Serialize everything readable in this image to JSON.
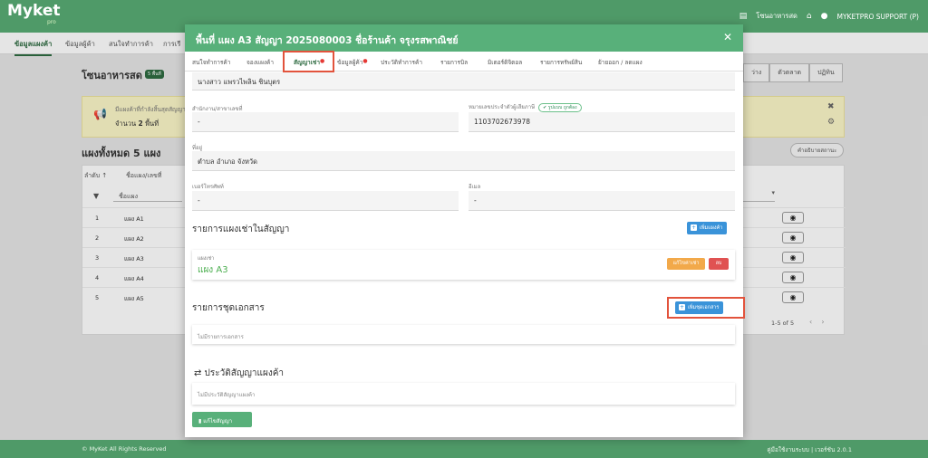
{
  "app": {
    "logo": "Myket",
    "logo_sub": "pro",
    "zone_link": "โซนอาหารสด",
    "user": "MYKETPRO SUPPORT (P)"
  },
  "nav": [
    "ข้อมูลแผงค้า",
    "ข้อมูลผู้ค้า",
    "สนใจทำการค้า",
    "การเรี"
  ],
  "page": {
    "title": "โซนอาหารสด",
    "count_badge": "5 พื้นที่",
    "right_tabs": [
      "ว่าง",
      "ตัวตลาด",
      "ปฏิทิน"
    ],
    "notice_line1": "มีแผงค้าที่กำลังสิ้นสุดสัญญา",
    "notice_line2_prefix": "จำนวน ",
    "notice_line2_count": "2",
    "notice_line2_suffix": " พื้นที่",
    "list_title": "แผงทั้งหมด 5 แผง",
    "help_btn": "คำอธิบายสถานะ",
    "table_headers": [
      "ลำดับ ↑",
      "ชื่อแผง/เลขที่"
    ],
    "filter_placeholder": "ชื่อแผง",
    "rows": [
      {
        "n": "1",
        "name": "แผง A1"
      },
      {
        "n": "2",
        "name": "แผง A2"
      },
      {
        "n": "3",
        "name": "แผง A3"
      },
      {
        "n": "4",
        "name": "แผง A4"
      },
      {
        "n": "5",
        "name": "แผง A5"
      }
    ],
    "pager": "1-5 of 5",
    "footer_left": "© MyKet All Rights Reserved",
    "footer_right": "คู่มือใช้งานระบบ | เวอร์ชัน 2.0.1"
  },
  "modal": {
    "title": "พื้นที่ แผง A3 สัญญา 2025080003 ชื่อร้านค้า จรุงรสพาณิชย์",
    "close": "✕",
    "tabs": [
      "สนใจทำการค้า",
      "จองแผงค้า",
      "สัญญาเช่า",
      "ข้อมูลผู้ค้า",
      "ประวัติทำการค้า",
      "รายการบิล",
      "มิเตอร์ดิจิตอล",
      "รายการทรัพย์สิน",
      "ย้ายออก / ลดแผง"
    ],
    "tenant_name": "นางสาว แพรวไพลิน ชินบุตร",
    "office_label": "สำนักงาน/สาขาเลขที่",
    "office_value": "-",
    "taxid_label": "หมายเลขประจำตัวผู้เสียภาษี",
    "taxid_badge": "รูปแบบ ถูกต้อง",
    "taxid_value": "1103702673978",
    "address_label": "ที่อยู่",
    "address_value": "ตำบล อำเภอ จังหวัด",
    "phone_label": "เบอร์โทรศัพท์",
    "phone_value": "-",
    "email_label": "อีเมล",
    "email_value": "-",
    "stalls_title": "รายการแผงเช่าในสัญญา",
    "add_stall_btn": "เพิ่มแผงค้า",
    "stall_label": "แผงเช่า",
    "stall_name": "แผง A3",
    "edit_price_btn": "แก้ไขค่าเช่า",
    "delete_btn": "ลบ",
    "docs_title": "รายการชุดเอกสาร",
    "add_docs_btn": "เพิ่มชุดเอกสาร",
    "docs_empty": "ไม่มีรายการเอกสาร",
    "history_title": "⇄ ประวัติสัญญาแผงค้า",
    "history_empty": "ไม่มีประวัติสัญญาแผงค้า",
    "edit_contract_btn": "แก้ไขสัญญา"
  },
  "colors": {
    "header_green": "#58b07a",
    "topbar_green": "#4f9a68",
    "accent_blue": "#3a93d9",
    "highlight_red": "#e2533c"
  }
}
